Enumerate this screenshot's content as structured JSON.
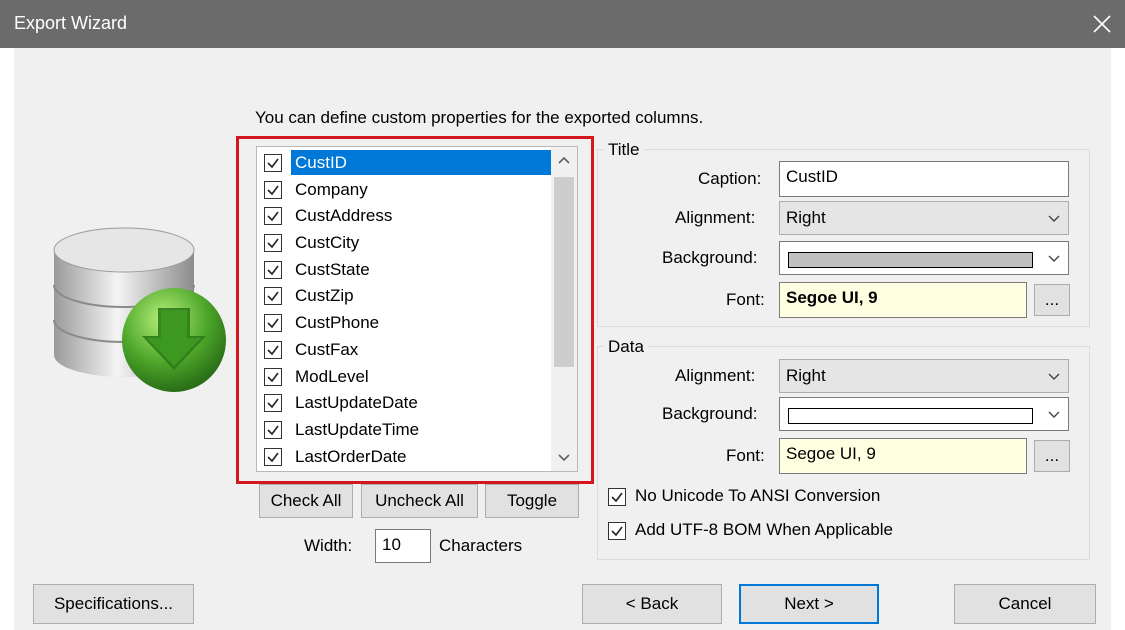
{
  "window": {
    "title": "Export Wizard",
    "close_icon": "close-icon"
  },
  "intro_text": "You can define custom properties for the exported columns.",
  "columns": {
    "items": [
      {
        "label": "CustID",
        "checked": true,
        "selected": true
      },
      {
        "label": "Company",
        "checked": true
      },
      {
        "label": "CustAddress",
        "checked": true
      },
      {
        "label": "CustCity",
        "checked": true
      },
      {
        "label": "CustState",
        "checked": true
      },
      {
        "label": "CustZip",
        "checked": true
      },
      {
        "label": "CustPhone",
        "checked": true
      },
      {
        "label": "CustFax",
        "checked": true
      },
      {
        "label": "ModLevel",
        "checked": true
      },
      {
        "label": "LastUpdateDate",
        "checked": true
      },
      {
        "label": "LastUpdateTime",
        "checked": true
      },
      {
        "label": "LastOrderDate",
        "checked": true
      }
    ],
    "check_all": "Check All",
    "uncheck_all": "Uncheck All",
    "toggle": "Toggle",
    "width_label": "Width:",
    "width_value": "10",
    "width_unit": "Characters"
  },
  "title_group": {
    "heading": "Title",
    "caption_label": "Caption:",
    "caption_value": "CustID",
    "alignment_label": "Alignment:",
    "alignment_value": "Right",
    "background_label": "Background:",
    "background_color": "#c0c0c0",
    "font_label": "Font:",
    "font_value": "Segoe UI, 9",
    "font_button": "..."
  },
  "data_group": {
    "heading": "Data",
    "alignment_label": "Alignment:",
    "alignment_value": "Right",
    "background_label": "Background:",
    "background_color": "#ffffff",
    "font_label": "Font:",
    "font_value": "Segoe UI, 9",
    "font_button": "..."
  },
  "options": {
    "no_unicode": {
      "label": "No Unicode To ANSI Conversion",
      "checked": true
    },
    "utf8_bom": {
      "label": "Add UTF-8 BOM When Applicable",
      "checked": true
    }
  },
  "footer": {
    "specifications": "Specifications...",
    "back": "< Back",
    "next": "Next >",
    "cancel": "Cancel"
  },
  "colors": {
    "selection": "#0078d7",
    "highlight_outline": "#d4171f",
    "titlebar": "#6b6b6b"
  }
}
